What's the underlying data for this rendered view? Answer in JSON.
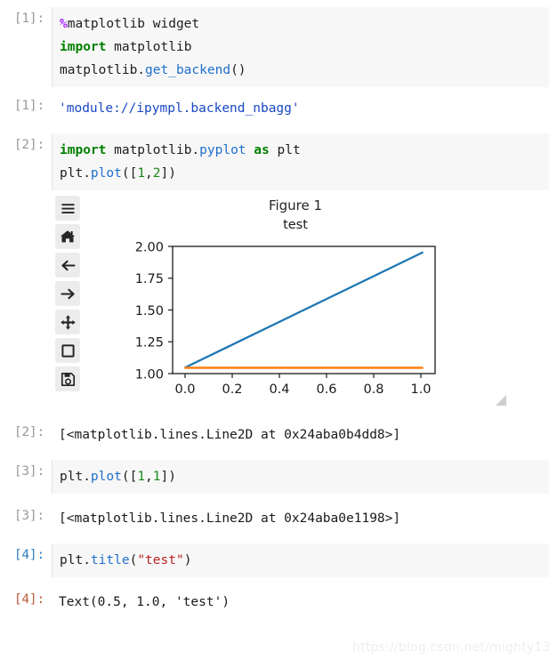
{
  "cells": [
    {
      "type": "input",
      "prompt": "[1]:",
      "prompt_state": "idle",
      "lines": [
        [
          {
            "t": "%",
            "c": "magic"
          },
          {
            "t": "matplotlib widget",
            "c": "plain"
          }
        ],
        [
          {
            "t": "import",
            "c": "kw"
          },
          {
            "t": " matplotlib",
            "c": "plain"
          }
        ],
        [
          {
            "t": "matplotlib.",
            "c": "plain"
          },
          {
            "t": "get_backend",
            "c": "fn"
          },
          {
            "t": "()",
            "c": "plain"
          }
        ]
      ]
    },
    {
      "type": "output",
      "prompt": "[1]:",
      "prompt_state": "idle",
      "text": "'module://ipympl.backend_nbagg'",
      "style": "string"
    },
    {
      "type": "input",
      "prompt": "[2]:",
      "prompt_state": "idle",
      "lines": [
        [
          {
            "t": "import",
            "c": "kw"
          },
          {
            "t": " matplotlib.",
            "c": "plain"
          },
          {
            "t": "pyplot",
            "c": "fn"
          },
          {
            "t": " ",
            "c": "plain"
          },
          {
            "t": "as",
            "c": "kw"
          },
          {
            "t": " plt",
            "c": "plain"
          }
        ],
        [
          {
            "t": "plt.",
            "c": "plain"
          },
          {
            "t": "plot",
            "c": "fn"
          },
          {
            "t": "([",
            "c": "plain"
          },
          {
            "t": "1",
            "c": "num"
          },
          {
            "t": ",",
            "c": "plain"
          },
          {
            "t": "2",
            "c": "num"
          },
          {
            "t": "])",
            "c": "plain"
          }
        ]
      ]
    },
    {
      "type": "output",
      "prompt": "[2]:",
      "prompt_state": "idle",
      "text": "[<matplotlib.lines.Line2D at 0x24aba0b4dd8>]",
      "style": "plain"
    },
    {
      "type": "input",
      "prompt": "[3]:",
      "prompt_state": "idle",
      "lines": [
        [
          {
            "t": "plt.",
            "c": "plain"
          },
          {
            "t": "plot",
            "c": "fn"
          },
          {
            "t": "([",
            "c": "plain"
          },
          {
            "t": "1",
            "c": "num"
          },
          {
            "t": ",",
            "c": "plain"
          },
          {
            "t": "1",
            "c": "num"
          },
          {
            "t": "])",
            "c": "plain"
          }
        ]
      ]
    },
    {
      "type": "output",
      "prompt": "[3]:",
      "prompt_state": "idle",
      "text": "[<matplotlib.lines.Line2D at 0x24aba0e1198>]",
      "style": "plain"
    },
    {
      "type": "input",
      "prompt": "[4]:",
      "prompt_state": "active",
      "lines": [
        [
          {
            "t": "plt.",
            "c": "plain"
          },
          {
            "t": "title",
            "c": "fn"
          },
          {
            "t": "(",
            "c": "plain"
          },
          {
            "t": "\"test\"",
            "c": "str"
          },
          {
            "t": ")",
            "c": "plain"
          }
        ]
      ]
    },
    {
      "type": "output",
      "prompt": "[4]:",
      "prompt_state": "active",
      "text": "Text(0.5, 1.0, 'test')",
      "style": "plain"
    }
  ],
  "figure_widget": {
    "header": "Figure 1",
    "toolbar": [
      {
        "name": "menu-icon",
        "tooltip": "Toggle Interaction"
      },
      {
        "name": "home-icon",
        "tooltip": "Reset original view"
      },
      {
        "name": "arrow-left-icon",
        "tooltip": "Back to previous view"
      },
      {
        "name": "arrow-right-icon",
        "tooltip": "Forward to next view"
      },
      {
        "name": "move-icon",
        "tooltip": "Pan axes with left mouse, zoom with right"
      },
      {
        "name": "square-icon",
        "tooltip": "Zoom to rectangle"
      },
      {
        "name": "save-icon",
        "tooltip": "Download plot"
      }
    ]
  },
  "chart_data": {
    "type": "line",
    "title": "test",
    "xlabel": "",
    "ylabel": "",
    "xlim": [
      -0.05,
      1.05
    ],
    "ylim": [
      0.95,
      2.05
    ],
    "xticks": [
      "0.0",
      "0.2",
      "0.4",
      "0.6",
      "0.8",
      "1.0"
    ],
    "xtick_values": [
      0.0,
      0.2,
      0.4,
      0.6,
      0.8,
      1.0
    ],
    "yticks": [
      "1.00",
      "1.25",
      "1.50",
      "1.75",
      "2.00"
    ],
    "ytick_values": [
      1.0,
      1.25,
      1.5,
      1.75,
      2.0
    ],
    "grid": false,
    "legend": false,
    "series": [
      {
        "name": "plt.plot([1,2])",
        "color": "#1f77b4",
        "x": [
          0,
          1
        ],
        "y": [
          1,
          2
        ]
      },
      {
        "name": "plt.plot([1,1])",
        "color": "#ff7f0e",
        "x": [
          0,
          1
        ],
        "y": [
          1,
          1
        ]
      }
    ]
  },
  "watermark": "https://blog.csdn.net/mighty13"
}
